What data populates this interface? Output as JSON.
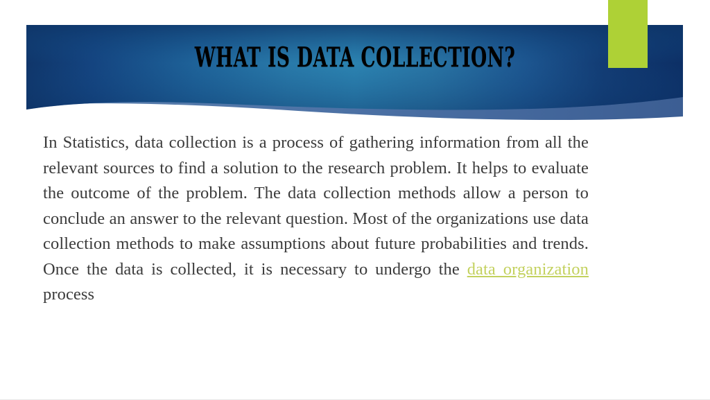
{
  "slide": {
    "background_color": "#ffffff",
    "title": "WHAT IS DATA COLLECTION?",
    "accent_bar_color": "#aed136",
    "banner": {
      "gradient_dark_navy": "#11386d",
      "gradient_teal": "#2b7ba4",
      "gradient_right_navy": "#0d2f66",
      "wave_light_blue": "#5c7fae"
    },
    "body": {
      "text_color": "#3b3b3b",
      "part1": "In Statistics, data collection is a process of gathering information from all the relevant sources to find a solution to the research problem. It helps to evaluate the outcome of the problem. The data collection methods allow a person to conclude an answer to the relevant question. Most of the organizations use data collection methods to make assumptions about future probabilities and trends. Once the data is collected, it is necessary to undergo the ",
      "link_text": "data organization",
      "link_color": "#c3d15e",
      "part2": " process"
    }
  }
}
